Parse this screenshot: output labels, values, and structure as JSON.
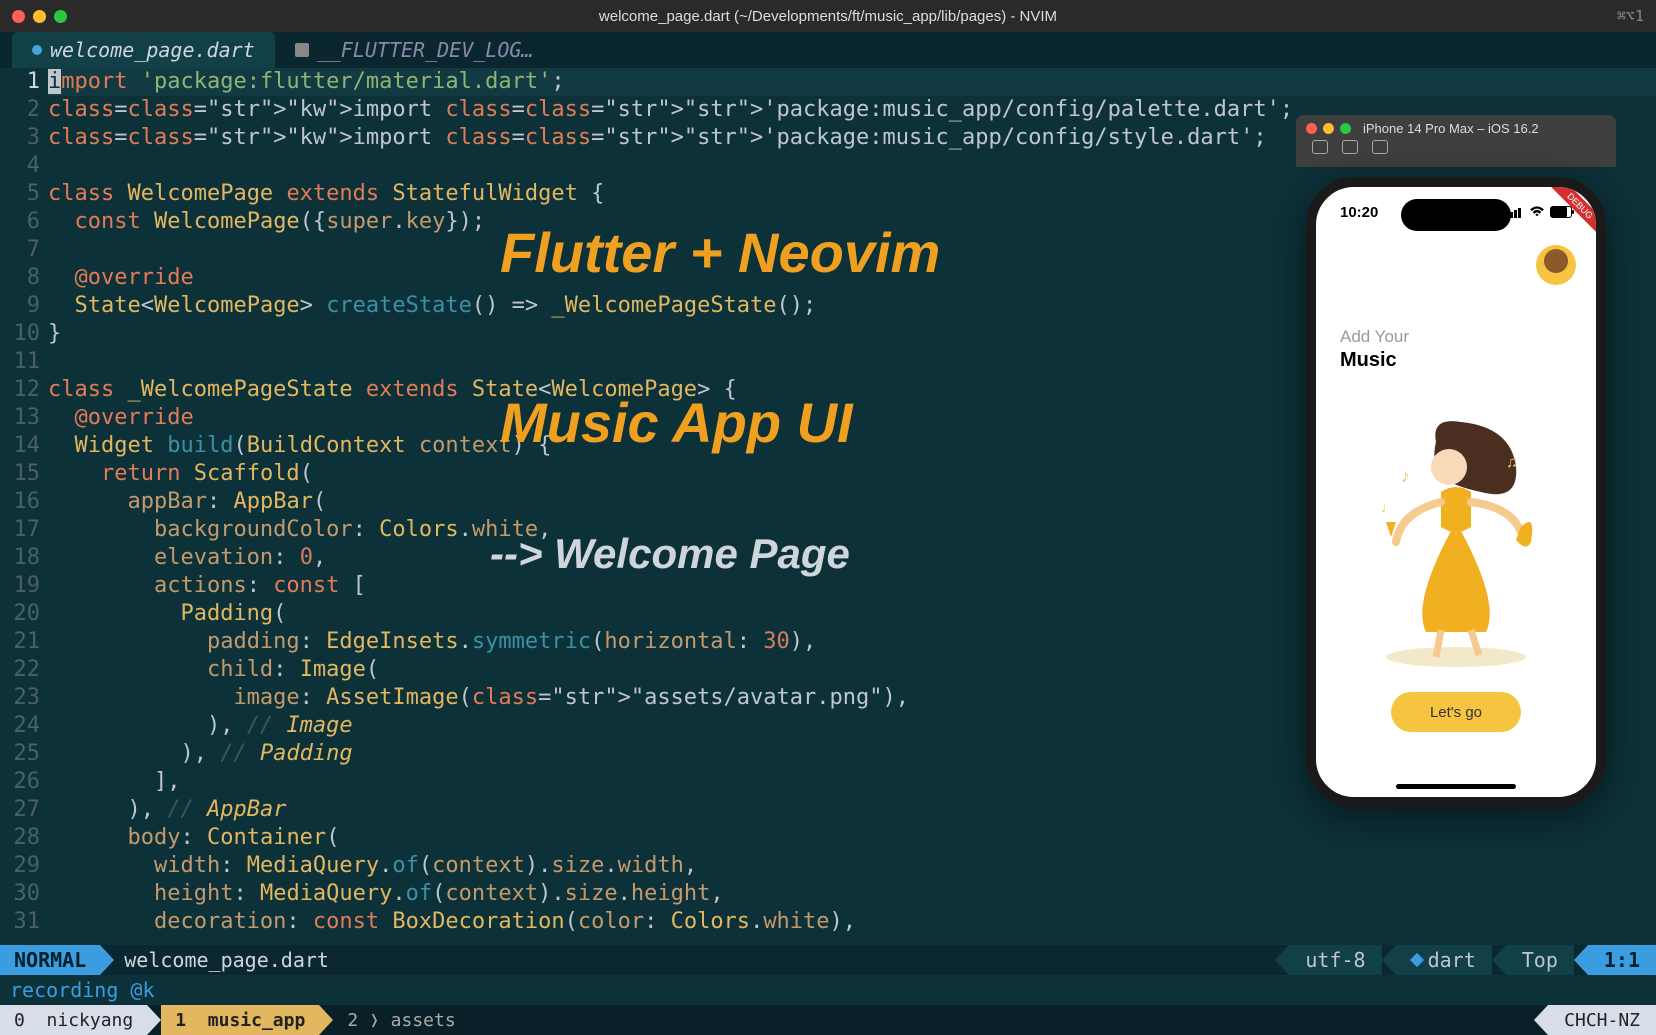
{
  "titlebar": {
    "title": "welcome_page.dart (~/Developments/ft/music_app/lib/pages) - NVIM",
    "shortcut": "⌘⌥1"
  },
  "tabs": [
    {
      "label": "welcome_page.dart",
      "active": true
    },
    {
      "label": "__FLUTTER_DEV_LOG…",
      "active": false
    }
  ],
  "editor": {
    "line_count": 31,
    "active_line": 1,
    "lines_raw": [
      "import 'package:flutter/material.dart';",
      "import 'package:music_app/config/palette.dart';",
      "import 'package:music_app/config/style.dart';",
      "",
      "class WelcomePage extends StatefulWidget {",
      "  const WelcomePage({super.key});",
      "",
      "  @override",
      "  State<WelcomePage> createState() => _WelcomePageState();",
      "}",
      "",
      "class _WelcomePageState extends State<WelcomePage> {",
      "  @override",
      "  Widget build(BuildContext context) {",
      "    return Scaffold(",
      "      appBar: AppBar(",
      "        backgroundColor: Colors.white,",
      "        elevation: 0,",
      "        actions: const [",
      "          Padding(",
      "            padding: EdgeInsets.symmetric(horizontal: 30),",
      "            child: Image(",
      "              image: AssetImage(\"assets/avatar.png\"),",
      "            ), // Image",
      "          ), // Padding",
      "        ],",
      "      ), // AppBar",
      "      body: Container(",
      "        width: MediaQuery.of(context).size.width,",
      "        height: MediaQuery.of(context).size.height,",
      "        decoration: const BoxDecoration(color: Colors.white),"
    ]
  },
  "overlays": {
    "line1": "Flutter + Neovim",
    "line2": "Music App UI",
    "line3": "--> Welcome Page"
  },
  "simulator": {
    "device_title": "iPhone 14 Pro Max – iOS 16.2",
    "time": "10:20",
    "debug_banner": "DEBUG",
    "content": {
      "add_your": "Add Your",
      "music": "Music",
      "button": "Let's go"
    }
  },
  "statusline": {
    "mode": "NORMAL",
    "filename": "welcome_page.dart",
    "encoding": "utf-8",
    "filetype": "dart",
    "scroll": "Top",
    "pos": "1:1"
  },
  "message": "recording @k",
  "tmux": {
    "session_index": "0",
    "session_name": "nickyang",
    "win1_index": "1",
    "win1_name": "music_app",
    "win2_index": "2",
    "win2_name": "assets",
    "right": "CHCH-NZ"
  }
}
